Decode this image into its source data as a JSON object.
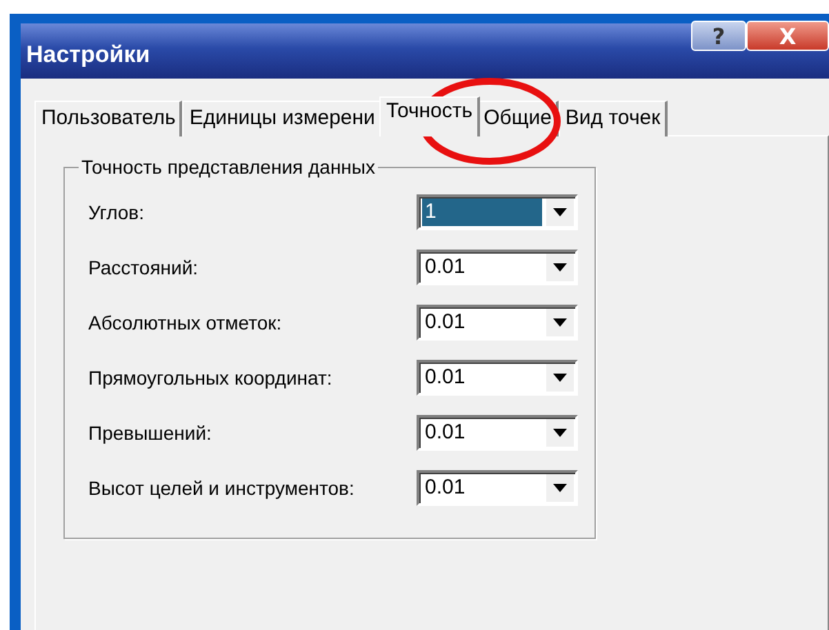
{
  "window": {
    "title": "Настройки",
    "buttons": [
      {
        "kind": "help",
        "label": "?"
      },
      {
        "kind": "close",
        "label": "X"
      }
    ]
  },
  "tabs": [
    {
      "label": "Пользователь",
      "selected": false
    },
    {
      "label": "Единицы измерени",
      "selected": false
    },
    {
      "label": "Точность",
      "selected": true
    },
    {
      "label": "Общие",
      "selected": false
    },
    {
      "label": "Вид точек",
      "selected": false
    }
  ],
  "group": {
    "title": "Точность представления данных",
    "fields": [
      {
        "label": "Углов:",
        "value": "1",
        "selected": true
      },
      {
        "label": "Расстояний:",
        "value": "0.01",
        "selected": false
      },
      {
        "label": "Абсолютных отметок:",
        "value": "0.01",
        "selected": false
      },
      {
        "label": "Прямоугольных координат:",
        "value": "0.01",
        "selected": false
      },
      {
        "label": "Превышений:",
        "value": "0.01",
        "selected": false
      },
      {
        "label": "Высот целей и инструментов:",
        "value": "0.01",
        "selected": false
      }
    ]
  }
}
